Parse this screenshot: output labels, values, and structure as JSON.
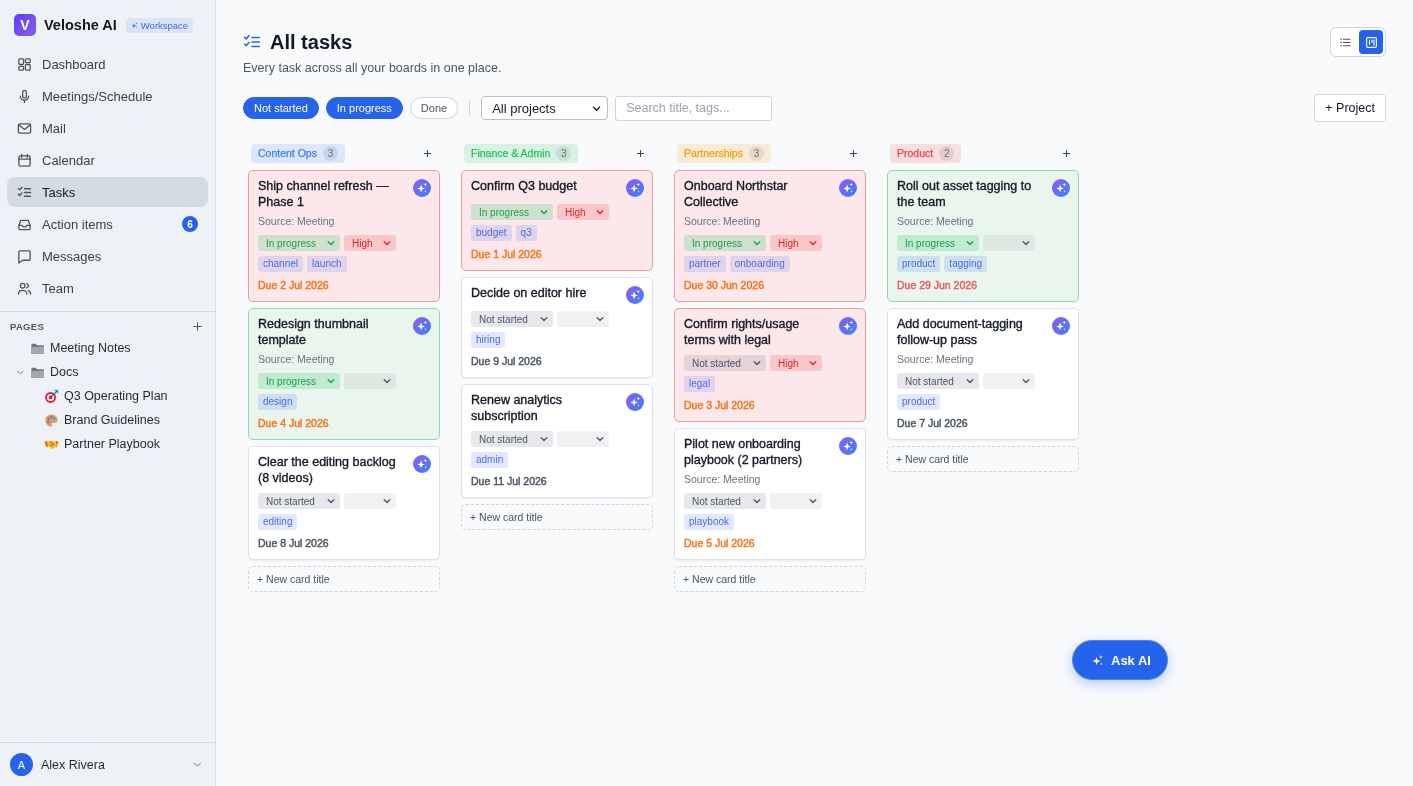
{
  "sidebar": {
    "brand": {
      "logo": "V",
      "name": "Veloshe AI",
      "badge": "Workspace"
    },
    "nav": [
      {
        "label": "Dashboard",
        "selected": false
      },
      {
        "label": "Meetings/Schedule",
        "selected": false
      },
      {
        "label": "Mail",
        "selected": false
      },
      {
        "label": "Calendar",
        "selected": false
      },
      {
        "label": "Tasks",
        "selected": true
      },
      {
        "label": "Action items",
        "selected": false,
        "count": "6"
      },
      {
        "label": "Messages",
        "selected": false
      },
      {
        "label": "Team",
        "selected": false
      }
    ],
    "pages": {
      "title": "PAGES",
      "items": [
        {
          "label": "Meeting Notes"
        },
        {
          "label": "Docs",
          "expanded": true,
          "children": [
            {
              "label": "Q3 Operating Plan"
            },
            {
              "label": "Brand Guidelines"
            },
            {
              "label": "Partner Playbook"
            }
          ]
        }
      ]
    },
    "user": {
      "initial": "A",
      "name": "Alex Rivera"
    }
  },
  "header": {
    "title": "All tasks",
    "subtitle": "Every task across all your boards in one place.",
    "views": [
      {
        "selected": false
      },
      {
        "selected": true
      }
    ]
  },
  "filters": {
    "statuses": [
      {
        "label": "Not started",
        "selected": true
      },
      {
        "label": "In progress",
        "selected": true
      },
      {
        "label": "Done",
        "selected": false
      }
    ],
    "project": "All projects",
    "search": {
      "placeholder": "Search title, tags..."
    },
    "add_project": "+ Project"
  },
  "columns": [
    {
      "name": "Content Ops",
      "count": "3",
      "color": "#3b82f6",
      "new_card": "+ New card title",
      "cards": [
        {
          "kind": "alert",
          "title": "Ship channel refresh — Phase 1",
          "source": "Source: Meeting",
          "status": {
            "label": "In progress",
            "kind": "progress"
          },
          "priority": {
            "label": "High",
            "kind": "high"
          },
          "tags": [
            "channel",
            "launch"
          ],
          "due": {
            "text": "Due 2 Jul 2026",
            "color": "#f97316"
          }
        },
        {
          "kind": "active",
          "title": "Redesign thumbnail template",
          "source": "Source: Meeting",
          "status": {
            "label": "In progress",
            "kind": "progress"
          },
          "tags": [
            "design"
          ],
          "due": {
            "text": "Due 4 Jul 2026",
            "color": "#f97316"
          }
        },
        {
          "kind": "plain",
          "title": "Clear the editing backlog (8 videos)",
          "status": {
            "label": "Not started",
            "kind": "todo"
          },
          "tags": [
            "editing"
          ],
          "due": {
            "text": "Due 8 Jul 2026",
            "color": "#4b5563"
          }
        }
      ]
    },
    {
      "name": "Finance & Admin",
      "count": "3",
      "color": "#22c55e",
      "new_card": "+ New card title",
      "cards": [
        {
          "kind": "alert",
          "title": "Confirm Q3 budget",
          "status": {
            "label": "In progress",
            "kind": "progress"
          },
          "priority": {
            "label": "High",
            "kind": "high"
          },
          "tags": [
            "budget",
            "q3"
          ],
          "due": {
            "text": "Due 1 Jul 2026",
            "color": "#f97316"
          }
        },
        {
          "kind": "plain",
          "title": "Decide on editor hire",
          "status": {
            "label": "Not started",
            "kind": "todo"
          },
          "tags": [
            "hiring"
          ],
          "due": {
            "text": "Due 9 Jul 2026",
            "color": "#4b5563"
          }
        },
        {
          "kind": "plain",
          "title": "Renew analytics subscription",
          "status": {
            "label": "Not started",
            "kind": "todo"
          },
          "tags": [
            "admin"
          ],
          "due": {
            "text": "Due 11 Jul 2026",
            "color": "#4b5563"
          }
        }
      ]
    },
    {
      "name": "Partnerships",
      "count": "3",
      "color": "#f59e0b",
      "new_card": "+ New card title",
      "cards": [
        {
          "kind": "alert",
          "title": "Onboard Northstar Collective",
          "source": "Source: Meeting",
          "status": {
            "label": "In progress",
            "kind": "progress"
          },
          "priority": {
            "label": "High",
            "kind": "high"
          },
          "tags": [
            "partner",
            "onboarding"
          ],
          "due": {
            "text": "Due 30 Jun 2026",
            "color": "#f97316"
          }
        },
        {
          "kind": "alert",
          "title": "Confirm rights/usage terms with legal",
          "status": {
            "label": "Not started",
            "kind": "todo"
          },
          "priority": {
            "label": "High",
            "kind": "high"
          },
          "tags": [
            "legal"
          ],
          "due": {
            "text": "Due 3 Jul 2026",
            "color": "#f97316"
          }
        },
        {
          "kind": "plain",
          "title": "Pilot new onboarding playbook (2 partners)",
          "source": "Source: Meeting",
          "status": {
            "label": "Not started",
            "kind": "todo"
          },
          "tags": [
            "playbook"
          ],
          "due": {
            "text": "Due 5 Jul 2026",
            "color": "#f97316"
          }
        }
      ]
    },
    {
      "name": "Product",
      "count": "2",
      "color": "#ef4444",
      "new_card": "+ New card title",
      "cards": [
        {
          "kind": "active",
          "title": "Roll out asset tagging to the team",
          "source": "Source: Meeting",
          "status": {
            "label": "In progress",
            "kind": "progress"
          },
          "tags": [
            "product",
            "tagging"
          ],
          "due": {
            "text": "Due 29 Jun 2026",
            "color": "#ef5b5b"
          }
        },
        {
          "kind": "plain",
          "title": "Add document-tagging follow-up pass",
          "source": "Source: Meeting",
          "status": {
            "label": "Not started",
            "kind": "todo"
          },
          "tags": [
            "product"
          ],
          "due": {
            "text": "Due 7 Jul 2026",
            "color": "#4b5563"
          }
        }
      ]
    }
  ],
  "ask_ai": "Ask AI"
}
